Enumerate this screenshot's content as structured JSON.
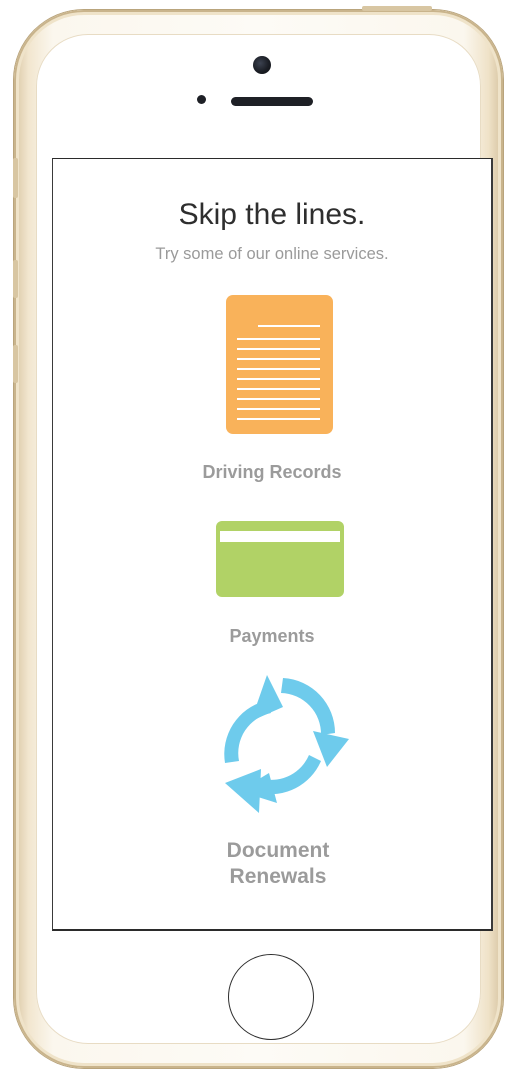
{
  "screen": {
    "headline": "Skip the lines.",
    "subheadline": "Try some of our online services."
  },
  "services": [
    {
      "label": "Driving Records",
      "icon": "document-icon",
      "color": "#f9b25a"
    },
    {
      "label": "Payments",
      "icon": "credit-card-icon",
      "color": "#b1d266"
    },
    {
      "label": "Document Renewals",
      "icon": "renew-cycle-icon",
      "color": "#6ecbec"
    }
  ],
  "device": {
    "model": "phone",
    "finish_color": "#f2e6cf"
  }
}
